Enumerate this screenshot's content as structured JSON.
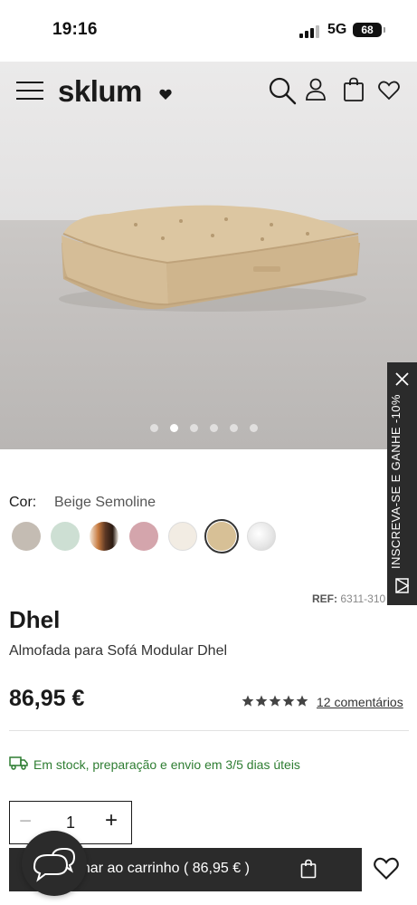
{
  "status_bar": {
    "time": "19:16",
    "network": "5G",
    "battery": "68"
  },
  "header": {
    "logo": "sklum",
    "icons": [
      "menu-icon",
      "search-icon",
      "user-icon",
      "bag-icon",
      "heart-icon"
    ]
  },
  "gallery": {
    "dot_count": 6,
    "active_index": 1
  },
  "promo": {
    "label": "INSCREVA-SE E GANHE -10%"
  },
  "color": {
    "label": "Cor:",
    "selected": "Beige Semoline",
    "swatches": [
      "#c4bcb3",
      "#cddfd3",
      "#8a5a3a",
      "#d4a5ac",
      "#f2ece3",
      "#d7c096",
      "#eeeeee"
    ],
    "selected_index": 5
  },
  "product": {
    "ref_label": "REF:",
    "ref_value": "6311-310",
    "name": "Dhel",
    "subtitle": "Almofada para Sofá Modular Dhel",
    "price": "86,95 €",
    "rating": 5,
    "reviews": "12 comentários"
  },
  "stock": {
    "text": "Em stock, preparação e envio em 3/5 dias úteis",
    "color": "#2e7d32"
  },
  "purchase": {
    "qty_minus": "−",
    "qty_value": "1",
    "qty_plus": "+",
    "add_to_cart_label": "onar ao carrinho ( 86,95 € )"
  },
  "colors": {
    "dark": "#2b2b2b",
    "accent_green": "#2e7d32"
  }
}
